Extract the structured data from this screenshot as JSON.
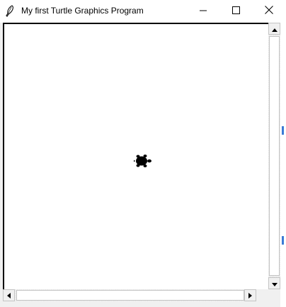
{
  "window": {
    "title": "My first Turtle Graphics Program",
    "app_icon": "feather-icon",
    "controls": {
      "minimize": "minimize-icon",
      "maximize": "maximize-icon",
      "close": "close-icon"
    }
  },
  "canvas": {
    "background": "#ffffff",
    "turtle_color": "#000000",
    "turtle_shape": "turtle-icon"
  },
  "scrollbars": {
    "vertical": {
      "up": "arrow-up-icon",
      "down": "arrow-down-icon"
    },
    "horizontal": {
      "left": "arrow-left-icon",
      "right": "arrow-right-icon"
    }
  }
}
